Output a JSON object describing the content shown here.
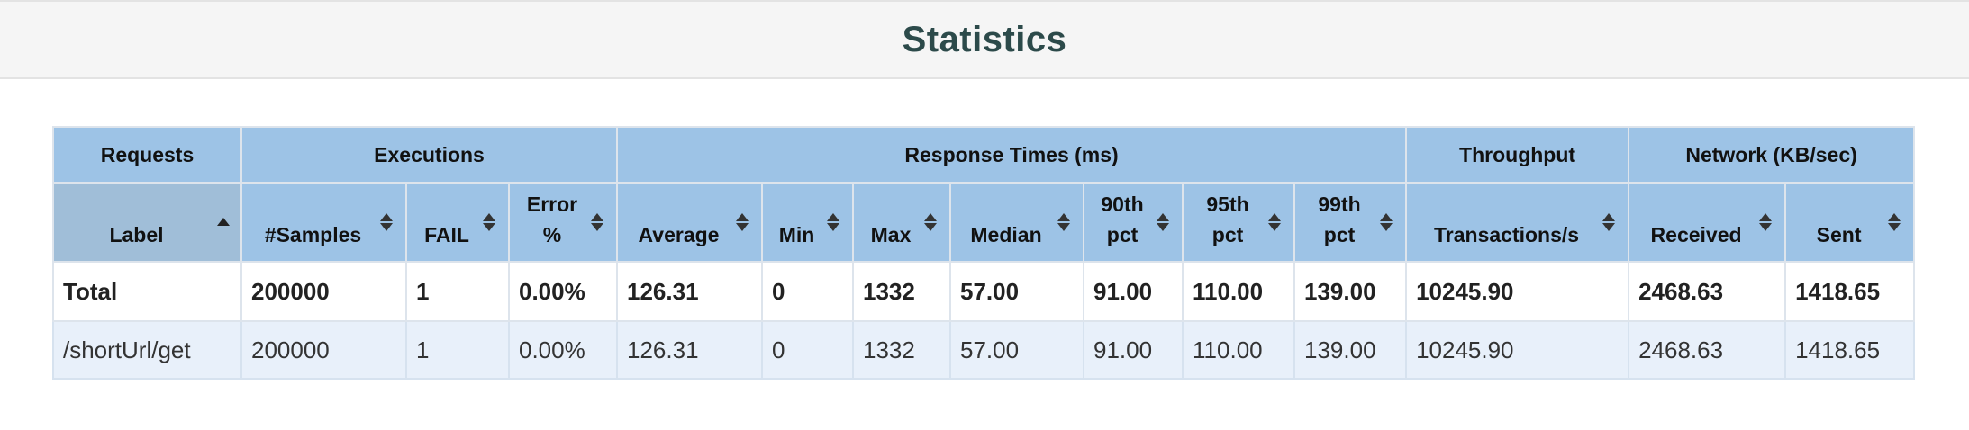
{
  "panel": {
    "title": "Statistics"
  },
  "groups": [
    {
      "label": "Requests"
    },
    {
      "label": "Executions"
    },
    {
      "label": "Response Times (ms)"
    },
    {
      "label": "Throughput"
    },
    {
      "label": "Network (KB/sec)"
    }
  ],
  "columns": [
    {
      "label": "Label"
    },
    {
      "label": "#Samples"
    },
    {
      "label": "FAIL"
    },
    {
      "label": "Error %"
    },
    {
      "label": "Average"
    },
    {
      "label": "Min"
    },
    {
      "label": "Max"
    },
    {
      "label": "Median"
    },
    {
      "label": "90th pct"
    },
    {
      "label": "95th pct"
    },
    {
      "label": "99th pct"
    },
    {
      "label": "Transactions/s"
    },
    {
      "label": "Received"
    },
    {
      "label": "Sent"
    }
  ],
  "rows": [
    {
      "cells": [
        "Total",
        "200000",
        "1",
        "0.00%",
        "126.31",
        "0",
        "1332",
        "57.00",
        "91.00",
        "110.00",
        "139.00",
        "10245.90",
        "2468.63",
        "1418.65"
      ]
    },
    {
      "cells": [
        "/shortUrl/get",
        "200000",
        "1",
        "0.00%",
        "126.31",
        "0",
        "1332",
        "57.00",
        "91.00",
        "110.00",
        "139.00",
        "10245.90",
        "2468.63",
        "1418.65"
      ]
    }
  ],
  "icons": {
    "sort_ascending": "sort-asc-icon",
    "sort_both": "sort-both-icon"
  },
  "colors": {
    "header_bg": "#9dc3e6",
    "title": "#2c4a4a",
    "row_alt": "#e8f0fa"
  }
}
